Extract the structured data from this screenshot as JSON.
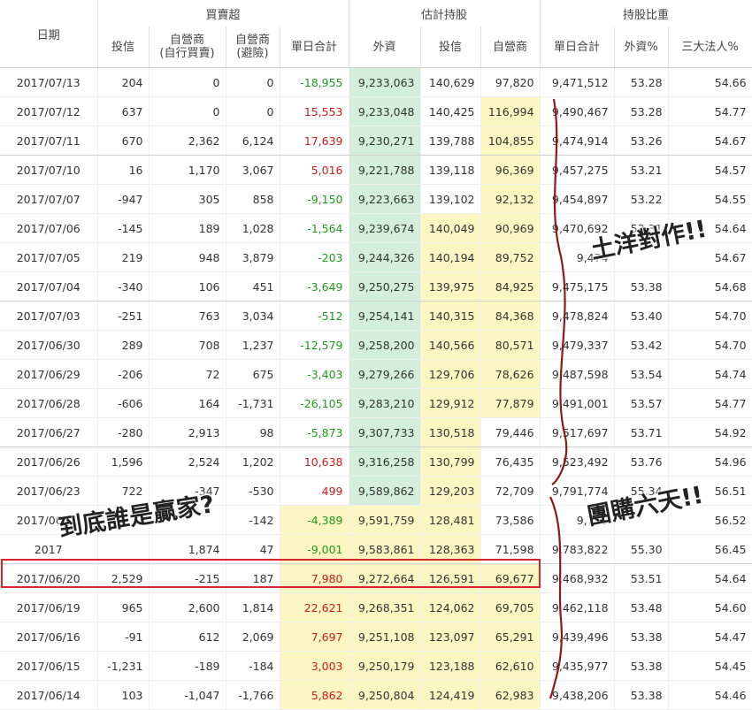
{
  "header": {
    "date": "日期",
    "group_trade": "買賣超",
    "group_hold": "估計持股",
    "group_ratio": "持股比重",
    "trade_cols": [
      "投信",
      "自營商\n(自行買賣)",
      "自營商\n(避險)",
      "單日合計"
    ],
    "hold_cols": [
      "外資",
      "投信",
      "自營商",
      "單日合計"
    ],
    "ratio_cols": [
      "外資%",
      "三大法人%"
    ]
  },
  "rows": [
    {
      "date": "2017/07/13",
      "trust": "204",
      "self": "0",
      "hedge": "0",
      "net": "-18,955",
      "f": "9,233,063",
      "t": "140,629",
      "s": "97,820",
      "total": "9,471,512",
      "fp": "53.28",
      "tp": "54.66"
    },
    {
      "date": "2017/07/12",
      "trust": "637",
      "self": "0",
      "hedge": "0",
      "net": "15,553",
      "f": "9,233,048",
      "t": "140,425",
      "s": "116,994",
      "total": "9,490,467",
      "fp": "53.28",
      "tp": "54.77"
    },
    {
      "date": "2017/07/11",
      "trust": "670",
      "self": "2,362",
      "hedge": "6,124",
      "net": "17,639",
      "f": "9,230,271",
      "t": "139,788",
      "s": "104,855",
      "total": "9,474,914",
      "fp": "53.26",
      "tp": "54.67"
    },
    {
      "date": "2017/07/10",
      "trust": "16",
      "self": "1,170",
      "hedge": "3,067",
      "net": "5,016",
      "f": "9,221,788",
      "t": "139,118",
      "s": "96,369",
      "total": "9,457,275",
      "fp": "53.21",
      "tp": "54.57"
    },
    {
      "date": "2017/07/07",
      "trust": "-947",
      "self": "305",
      "hedge": "858",
      "net": "-9,150",
      "f": "9,223,663",
      "t": "139,102",
      "s": "92,132",
      "total": "9,454,897",
      "fp": "53.22",
      "tp": "54.55"
    },
    {
      "date": "2017/07/06",
      "trust": "-145",
      "self": "189",
      "hedge": "1,028",
      "net": "-1,564",
      "f": "9,239,674",
      "t": "140,049",
      "s": "90,969",
      "total": "9,470,692",
      "fp": "53.31",
      "tp": "54.64"
    },
    {
      "date": "2017/07/05",
      "trust": "219",
      "self": "948",
      "hedge": "3,879",
      "net": "-203",
      "f": "9,244,326",
      "t": "140,194",
      "s": "89,752",
      "total": "9,474",
      "fp": "",
      "tp": "54.67"
    },
    {
      "date": "2017/07/04",
      "trust": "-340",
      "self": "106",
      "hedge": "451",
      "net": "-3,649",
      "f": "9,250,275",
      "t": "139,975",
      "s": "84,925",
      "total": "9,475,175",
      "fp": "53.38",
      "tp": "54.68"
    },
    {
      "date": "2017/07/03",
      "trust": "-251",
      "self": "763",
      "hedge": "3,034",
      "net": "-512",
      "f": "9,254,141",
      "t": "140,315",
      "s": "84,368",
      "total": "9,478,824",
      "fp": "53.40",
      "tp": "54.70"
    },
    {
      "date": "2017/06/30",
      "trust": "289",
      "self": "708",
      "hedge": "1,237",
      "net": "-12,579",
      "f": "9,258,200",
      "t": "140,566",
      "s": "80,571",
      "total": "9,479,337",
      "fp": "53.42",
      "tp": "54.70"
    },
    {
      "date": "2017/06/29",
      "trust": "-206",
      "self": "72",
      "hedge": "675",
      "net": "-3,403",
      "f": "9,279,266",
      "t": "129,706",
      "s": "78,626",
      "total": "9,487,598",
      "fp": "53.54",
      "tp": "54.74"
    },
    {
      "date": "2017/06/28",
      "trust": "-606",
      "self": "164",
      "hedge": "-1,731",
      "net": "-26,105",
      "f": "9,283,210",
      "t": "129,912",
      "s": "77,879",
      "total": "9,491,001",
      "fp": "53.57",
      "tp": "54.77"
    },
    {
      "date": "2017/06/27",
      "trust": "-280",
      "self": "2,913",
      "hedge": "98",
      "net": "-5,873",
      "f": "9,307,733",
      "t": "130,518",
      "s": "79,446",
      "total": "9,517,697",
      "fp": "53.71",
      "tp": "54.92"
    },
    {
      "date": "2017/06/26",
      "trust": "1,596",
      "self": "2,524",
      "hedge": "1,202",
      "net": "10,638",
      "f": "9,316,258",
      "t": "130,799",
      "s": "76,435",
      "total": "9,523,492",
      "fp": "53.76",
      "tp": "54.96"
    },
    {
      "date": "2017/06/23",
      "trust": "722",
      "self": "-347",
      "hedge": "-530",
      "net": "499",
      "f": "9,589,862",
      "t": "129,203",
      "s": "72,709",
      "total": "9,791,774",
      "fp": "55.34",
      "tp": "56.51"
    },
    {
      "date": "2017/06/22",
      "trust": "",
      "self": "",
      "hedge": "-142",
      "net": "-4,389",
      "f": "9,591,759",
      "t": "128,481",
      "s": "73,586",
      "total": "9,793",
      "fp": "",
      "tp": "56.52"
    },
    {
      "date": "2017",
      "trust": "",
      "self": "1,874",
      "hedge": "47",
      "net": "-9,001",
      "f": "9,583,861",
      "t": "128,363",
      "s": "71,598",
      "total": "9,783,822",
      "fp": "55.30",
      "tp": "56.45"
    },
    {
      "date": "2017/06/20",
      "trust": "2,529",
      "self": "-215",
      "hedge": "187",
      "net": "7,980",
      "f": "9,272,664",
      "t": "126,591",
      "s": "69,677",
      "total": "9,468,932",
      "fp": "53.51",
      "tp": "54.64"
    },
    {
      "date": "2017/06/19",
      "trust": "965",
      "self": "2,600",
      "hedge": "1,814",
      "net": "22,621",
      "f": "9,268,351",
      "t": "124,062",
      "s": "69,705",
      "total": "9,462,118",
      "fp": "53.48",
      "tp": "54.60"
    },
    {
      "date": "2017/06/16",
      "trust": "-91",
      "self": "612",
      "hedge": "2,069",
      "net": "7,697",
      "f": "9,251,108",
      "t": "123,097",
      "s": "65,291",
      "total": "9,439,496",
      "fp": "53.38",
      "tp": "54.47"
    },
    {
      "date": "2017/06/15",
      "trust": "-1,231",
      "self": "-189",
      "hedge": "-184",
      "net": "3,003",
      "f": "9,250,179",
      "t": "123,188",
      "s": "62,610",
      "total": "9,435,977",
      "fp": "53.38",
      "tp": "54.45"
    },
    {
      "date": "2017/06/14",
      "trust": "103",
      "self": "-1,047",
      "hedge": "-1,766",
      "net": "5,862",
      "f": "9,250,804",
      "t": "124,419",
      "s": "62,983",
      "total": "9,438,206",
      "fp": "53.38",
      "tp": "54.46"
    }
  ],
  "annotations": {
    "note1": "土洋對作!!",
    "note2": "團購六天!!",
    "note3": "到底誰是贏家?"
  },
  "colors": {
    "positive": "#d11a1a",
    "negative": "#1f9a1f",
    "foreign_bg": "#d3eedd",
    "yellow_bg": "#fcf7c2",
    "highlight": "#d8262e",
    "ink": "#8b1a1a"
  }
}
